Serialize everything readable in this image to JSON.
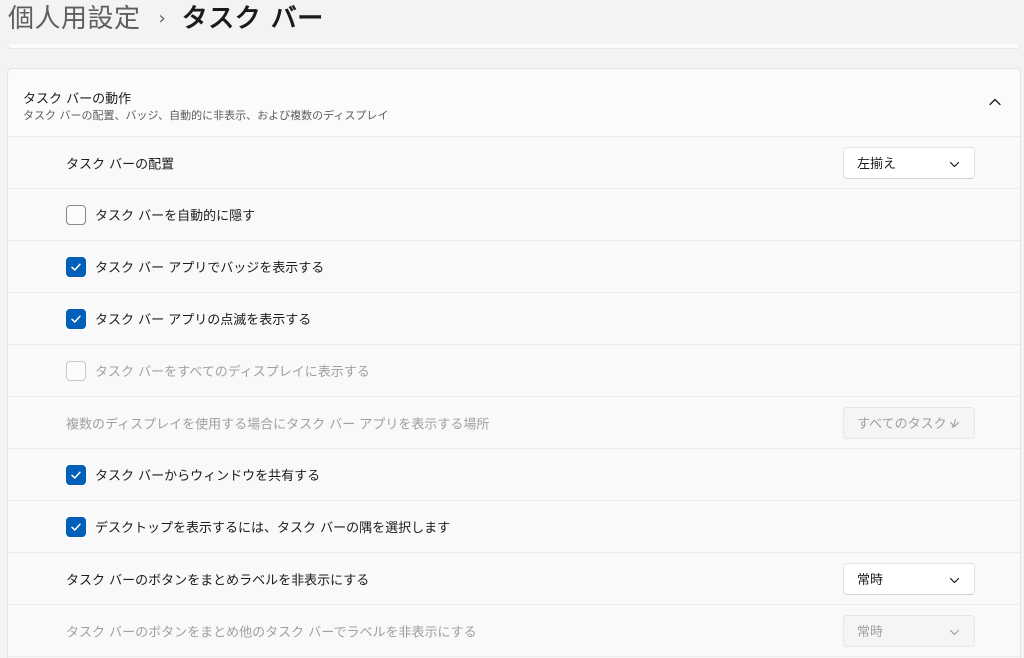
{
  "header": {
    "parent": "個人用設定",
    "separator": "›",
    "current": "タスク バー"
  },
  "section": {
    "title": "タスク バーの動作",
    "subtitle": "タスク バーの配置、バッジ、自動的に非表示、および複数のディスプレイ"
  },
  "rows": {
    "alignment": {
      "label": "タスク バーの配置",
      "value": "左揃え"
    },
    "autohide": {
      "label": "タスク バーを自動的に隠す",
      "checked": false
    },
    "badges": {
      "label": "タスク バー アプリでバッジを表示する",
      "checked": true
    },
    "flashing": {
      "label": "タスク バー アプリの点滅を表示する",
      "checked": true
    },
    "all_displays": {
      "label": "タスク バーをすべてのディスプレイに表示する",
      "checked": false,
      "disabled": true
    },
    "multi_display_apps": {
      "label": "複数のディスプレイを使用する場合にタスク バー アプリを表示する場所",
      "value": "すべてのタスク バー",
      "disabled": true
    },
    "share_window": {
      "label": "タスク バーからウィンドウを共有する",
      "checked": true
    },
    "show_desktop": {
      "label": "デスクトップを表示するには、タスク バーの隅を選択します",
      "checked": true
    },
    "combine_buttons": {
      "label": "タスク バーのボタンをまとめラベルを非表示にする",
      "value": "常時"
    },
    "combine_other": {
      "label": "タスク バーのボタンをまとめ他のタスク バーでラベルを非表示にする",
      "value": "常時",
      "disabled": true
    }
  },
  "colors": {
    "accent": "#005fb8",
    "disabled_text": "#a0a0a0"
  }
}
